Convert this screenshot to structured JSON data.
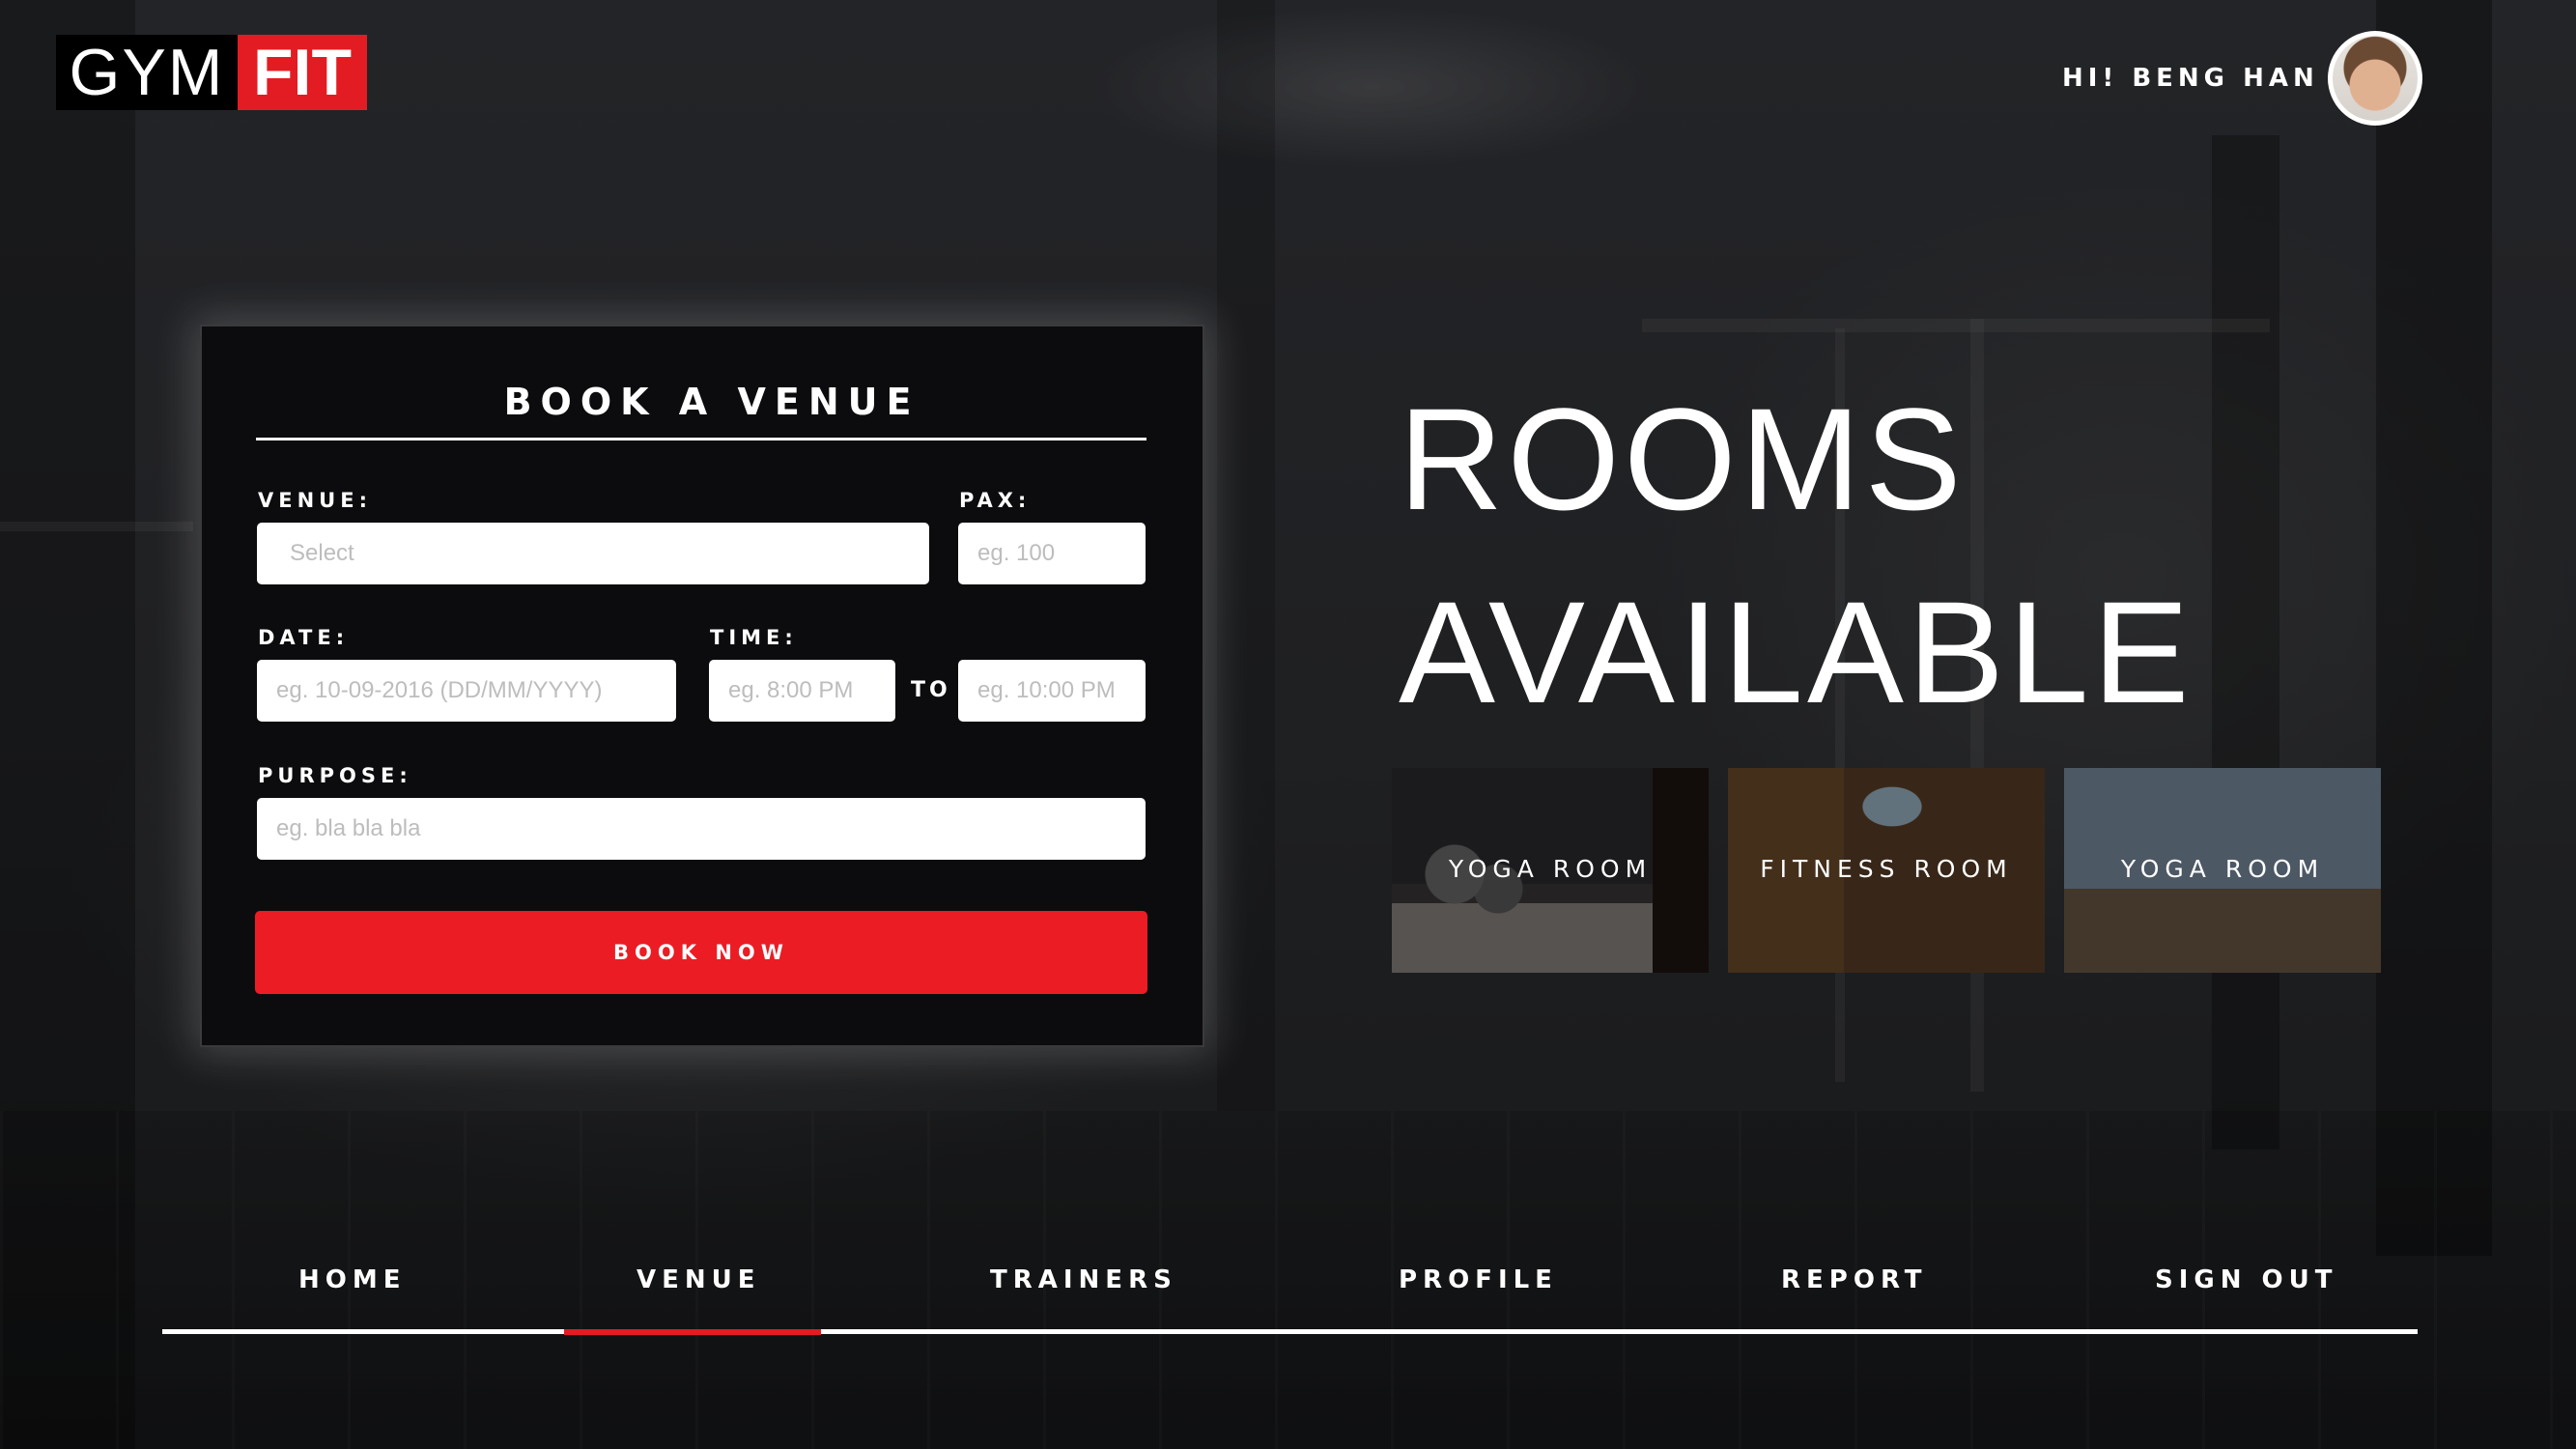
{
  "brand": {
    "logo_left": "GYM",
    "logo_right": "FIT",
    "accent": "#e31c23"
  },
  "header": {
    "greeting": "HI! BENG HAN"
  },
  "booking": {
    "title": "BOOK A VENUE",
    "venue_label": "VENUE:",
    "venue_placeholder": "Select",
    "pax_label": "PAX:",
    "pax_placeholder": "eg. 100",
    "date_label": "DATE:",
    "date_placeholder": "eg. 10-09-2016 (DD/MM/YYYY)",
    "time_label": "TIME:",
    "time_from_placeholder": "eg. 8:00 PM",
    "to_label": "TO",
    "time_to_placeholder": "eg. 10:00 PM",
    "purpose_label": "PURPOSE:",
    "purpose_placeholder": "eg. bla bla bla",
    "submit_label": "BOOK NOW"
  },
  "headline": {
    "line1": "ROOMS",
    "line2": "AVAILABLE"
  },
  "rooms": [
    {
      "name": "YOGA ROOM"
    },
    {
      "name": "FITNESS ROOM"
    },
    {
      "name": "YOGA ROOM"
    }
  ],
  "nav": {
    "items": [
      {
        "label": "HOME"
      },
      {
        "label": "VENUE"
      },
      {
        "label": "TRAINERS"
      },
      {
        "label": "PROFILE"
      },
      {
        "label": "REPORT"
      },
      {
        "label": "SIGN OUT"
      }
    ],
    "active": "VENUE"
  }
}
